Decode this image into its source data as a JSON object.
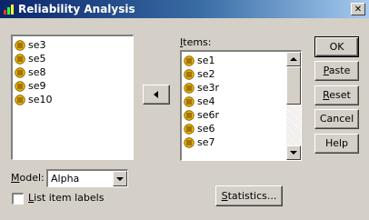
{
  "window": {
    "title": "Reliability Analysis",
    "close_glyph": "✕",
    "app_icon": "spss-app-icon",
    "title_gradient": [
      "#0a246a",
      "#a6caf0"
    ]
  },
  "source_list": {
    "items": [
      {
        "label": "se3"
      },
      {
        "label": "se5"
      },
      {
        "label": "se8"
      },
      {
        "label": "se9"
      },
      {
        "label": "se10"
      }
    ]
  },
  "move_button": {
    "icon": "arrow-left-icon"
  },
  "items_list": {
    "label_prefix": "",
    "label_access": "I",
    "label_rest": "tems:",
    "items": [
      {
        "label": "se1"
      },
      {
        "label": "se2"
      },
      {
        "label": "se3r"
      },
      {
        "label": "se4"
      },
      {
        "label": "se6r"
      },
      {
        "label": "se6"
      },
      {
        "label": "se7"
      }
    ]
  },
  "buttons": {
    "ok": "OK",
    "paste_access": "P",
    "paste_rest": "aste",
    "reset_access": "R",
    "reset_rest": "eset",
    "cancel": "Cancel",
    "help": "Help",
    "statistics_access": "S",
    "statistics_rest": "tatistics..."
  },
  "model": {
    "label_access": "M",
    "label_rest": "odel:",
    "value": "Alpha"
  },
  "list_item_labels": {
    "label_access": "L",
    "label_rest": "ist item labels",
    "checked": false
  },
  "colors": {
    "dialog_bg": "#d4d0c8",
    "title_bar": "#0a246a",
    "variable_icon_fill": "#e8b000"
  }
}
